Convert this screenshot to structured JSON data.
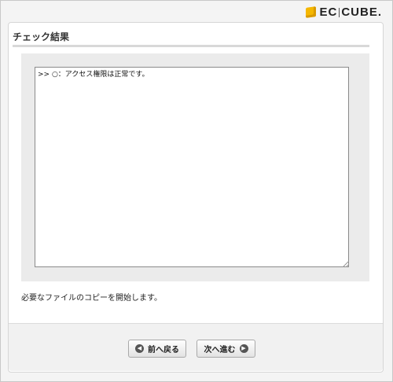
{
  "logo": {
    "text_left": "EC",
    "text_right": "CUBE."
  },
  "section": {
    "title": "チェック結果"
  },
  "log": {
    "text": ">> ○：アクセス権限は正常です。"
  },
  "message": "必要なファイルのコピーを開始します。",
  "buttons": {
    "back_label": "前へ戻る",
    "next_label": "次へ進む"
  },
  "colors": {
    "logo_accent": "#f5b700"
  }
}
